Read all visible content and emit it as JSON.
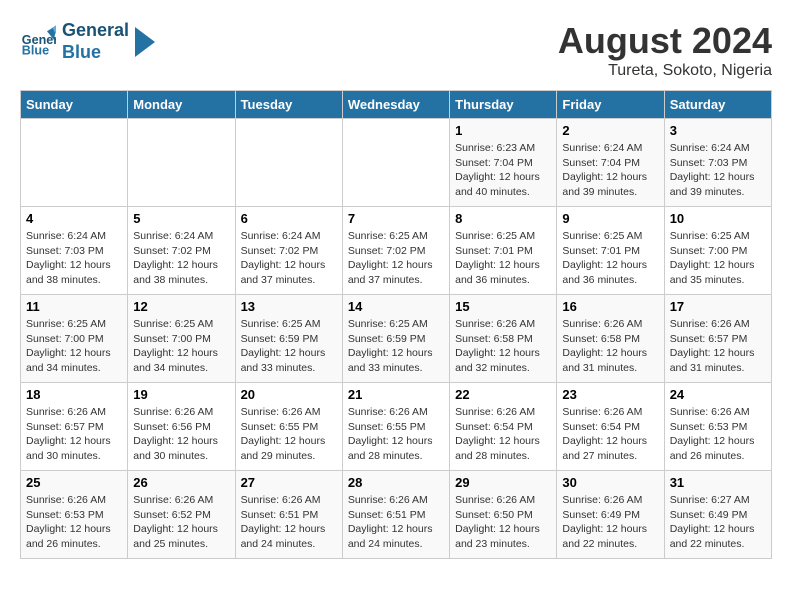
{
  "header": {
    "logo_text_line1": "General",
    "logo_text_line2": "Blue",
    "month_year": "August 2024",
    "location": "Tureta, Sokoto, Nigeria"
  },
  "days_of_week": [
    "Sunday",
    "Monday",
    "Tuesday",
    "Wednesday",
    "Thursday",
    "Friday",
    "Saturday"
  ],
  "weeks": [
    [
      {
        "day": "",
        "info": ""
      },
      {
        "day": "",
        "info": ""
      },
      {
        "day": "",
        "info": ""
      },
      {
        "day": "",
        "info": ""
      },
      {
        "day": "1",
        "info": "Sunrise: 6:23 AM\nSunset: 7:04 PM\nDaylight: 12 hours\nand 40 minutes."
      },
      {
        "day": "2",
        "info": "Sunrise: 6:24 AM\nSunset: 7:04 PM\nDaylight: 12 hours\nand 39 minutes."
      },
      {
        "day": "3",
        "info": "Sunrise: 6:24 AM\nSunset: 7:03 PM\nDaylight: 12 hours\nand 39 minutes."
      }
    ],
    [
      {
        "day": "4",
        "info": "Sunrise: 6:24 AM\nSunset: 7:03 PM\nDaylight: 12 hours\nand 38 minutes."
      },
      {
        "day": "5",
        "info": "Sunrise: 6:24 AM\nSunset: 7:02 PM\nDaylight: 12 hours\nand 38 minutes."
      },
      {
        "day": "6",
        "info": "Sunrise: 6:24 AM\nSunset: 7:02 PM\nDaylight: 12 hours\nand 37 minutes."
      },
      {
        "day": "7",
        "info": "Sunrise: 6:25 AM\nSunset: 7:02 PM\nDaylight: 12 hours\nand 37 minutes."
      },
      {
        "day": "8",
        "info": "Sunrise: 6:25 AM\nSunset: 7:01 PM\nDaylight: 12 hours\nand 36 minutes."
      },
      {
        "day": "9",
        "info": "Sunrise: 6:25 AM\nSunset: 7:01 PM\nDaylight: 12 hours\nand 36 minutes."
      },
      {
        "day": "10",
        "info": "Sunrise: 6:25 AM\nSunset: 7:00 PM\nDaylight: 12 hours\nand 35 minutes."
      }
    ],
    [
      {
        "day": "11",
        "info": "Sunrise: 6:25 AM\nSunset: 7:00 PM\nDaylight: 12 hours\nand 34 minutes."
      },
      {
        "day": "12",
        "info": "Sunrise: 6:25 AM\nSunset: 7:00 PM\nDaylight: 12 hours\nand 34 minutes."
      },
      {
        "day": "13",
        "info": "Sunrise: 6:25 AM\nSunset: 6:59 PM\nDaylight: 12 hours\nand 33 minutes."
      },
      {
        "day": "14",
        "info": "Sunrise: 6:25 AM\nSunset: 6:59 PM\nDaylight: 12 hours\nand 33 minutes."
      },
      {
        "day": "15",
        "info": "Sunrise: 6:26 AM\nSunset: 6:58 PM\nDaylight: 12 hours\nand 32 minutes."
      },
      {
        "day": "16",
        "info": "Sunrise: 6:26 AM\nSunset: 6:58 PM\nDaylight: 12 hours\nand 31 minutes."
      },
      {
        "day": "17",
        "info": "Sunrise: 6:26 AM\nSunset: 6:57 PM\nDaylight: 12 hours\nand 31 minutes."
      }
    ],
    [
      {
        "day": "18",
        "info": "Sunrise: 6:26 AM\nSunset: 6:57 PM\nDaylight: 12 hours\nand 30 minutes."
      },
      {
        "day": "19",
        "info": "Sunrise: 6:26 AM\nSunset: 6:56 PM\nDaylight: 12 hours\nand 30 minutes."
      },
      {
        "day": "20",
        "info": "Sunrise: 6:26 AM\nSunset: 6:55 PM\nDaylight: 12 hours\nand 29 minutes."
      },
      {
        "day": "21",
        "info": "Sunrise: 6:26 AM\nSunset: 6:55 PM\nDaylight: 12 hours\nand 28 minutes."
      },
      {
        "day": "22",
        "info": "Sunrise: 6:26 AM\nSunset: 6:54 PM\nDaylight: 12 hours\nand 28 minutes."
      },
      {
        "day": "23",
        "info": "Sunrise: 6:26 AM\nSunset: 6:54 PM\nDaylight: 12 hours\nand 27 minutes."
      },
      {
        "day": "24",
        "info": "Sunrise: 6:26 AM\nSunset: 6:53 PM\nDaylight: 12 hours\nand 26 minutes."
      }
    ],
    [
      {
        "day": "25",
        "info": "Sunrise: 6:26 AM\nSunset: 6:53 PM\nDaylight: 12 hours\nand 26 minutes."
      },
      {
        "day": "26",
        "info": "Sunrise: 6:26 AM\nSunset: 6:52 PM\nDaylight: 12 hours\nand 25 minutes."
      },
      {
        "day": "27",
        "info": "Sunrise: 6:26 AM\nSunset: 6:51 PM\nDaylight: 12 hours\nand 24 minutes."
      },
      {
        "day": "28",
        "info": "Sunrise: 6:26 AM\nSunset: 6:51 PM\nDaylight: 12 hours\nand 24 minutes."
      },
      {
        "day": "29",
        "info": "Sunrise: 6:26 AM\nSunset: 6:50 PM\nDaylight: 12 hours\nand 23 minutes."
      },
      {
        "day": "30",
        "info": "Sunrise: 6:26 AM\nSunset: 6:49 PM\nDaylight: 12 hours\nand 22 minutes."
      },
      {
        "day": "31",
        "info": "Sunrise: 6:27 AM\nSunset: 6:49 PM\nDaylight: 12 hours\nand 22 minutes."
      }
    ]
  ]
}
